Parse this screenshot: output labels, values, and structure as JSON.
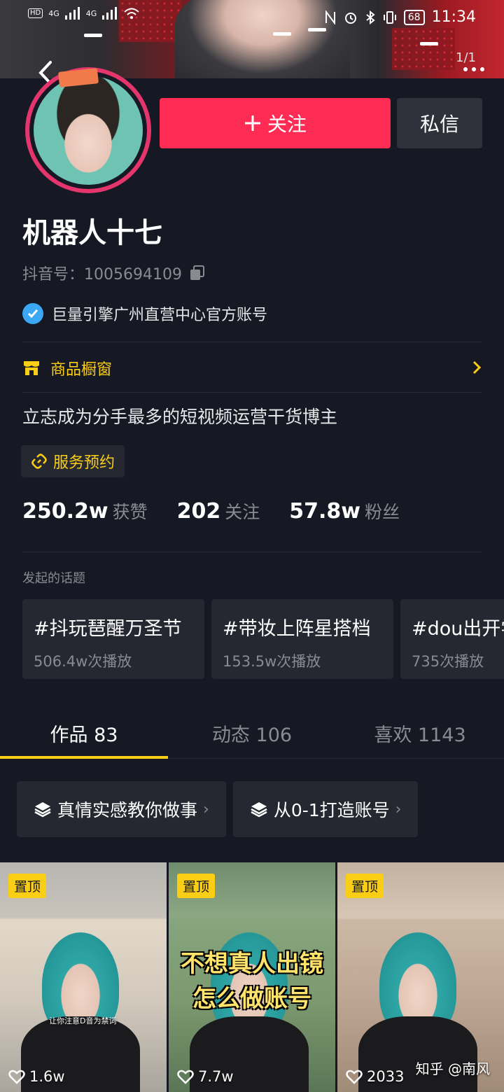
{
  "status_bar": {
    "left_labels": [
      "HD",
      "4G",
      "4G"
    ],
    "battery": "68",
    "time": "11:34"
  },
  "header": {
    "pager": "1/1"
  },
  "profile": {
    "follow_label": "关注",
    "message_label": "私信",
    "name": "机器人十七",
    "douyin_id": "抖音号：1005694109",
    "verified_text": "巨量引擎广州直营中心官方账号",
    "shop_label": "商品橱窗",
    "bio": "立志成为分手最多的短视频运营干货博主",
    "service_label": "服务预约"
  },
  "stats": [
    {
      "value": "250.2w",
      "label": "获赞"
    },
    {
      "value": "202",
      "label": "关注"
    },
    {
      "value": "57.8w",
      "label": "粉丝"
    }
  ],
  "topics": {
    "title": "发起的话题",
    "items": [
      {
        "name": "#抖玩琶醒万圣节",
        "plays": "506.4w次播放"
      },
      {
        "name": "#带妆上阵星搭档",
        "plays": "153.5w次播放"
      },
      {
        "name": "#dou出开学",
        "plays": "735次播放"
      }
    ]
  },
  "tabs": [
    {
      "label": "作品 83"
    },
    {
      "label": "动态 106"
    },
    {
      "label": "喜欢 1143"
    }
  ],
  "collections": [
    {
      "label": "真情实感教你做事"
    },
    {
      "label": "从0-1打造账号"
    }
  ],
  "videos": [
    {
      "badge": "置顶",
      "likes": "1.6w",
      "caption": "让你注意D音为禁词"
    },
    {
      "badge": "置顶",
      "likes": "7.7w",
      "title": "不想真人出镜怎么做账号"
    },
    {
      "badge": "置顶",
      "likes": "2033"
    }
  ],
  "watermark": "知乎 @南风",
  "colors": {
    "accent": "#fe2c55",
    "highlight": "#face15",
    "background": "#161823",
    "verified": "#3ba7f5"
  }
}
